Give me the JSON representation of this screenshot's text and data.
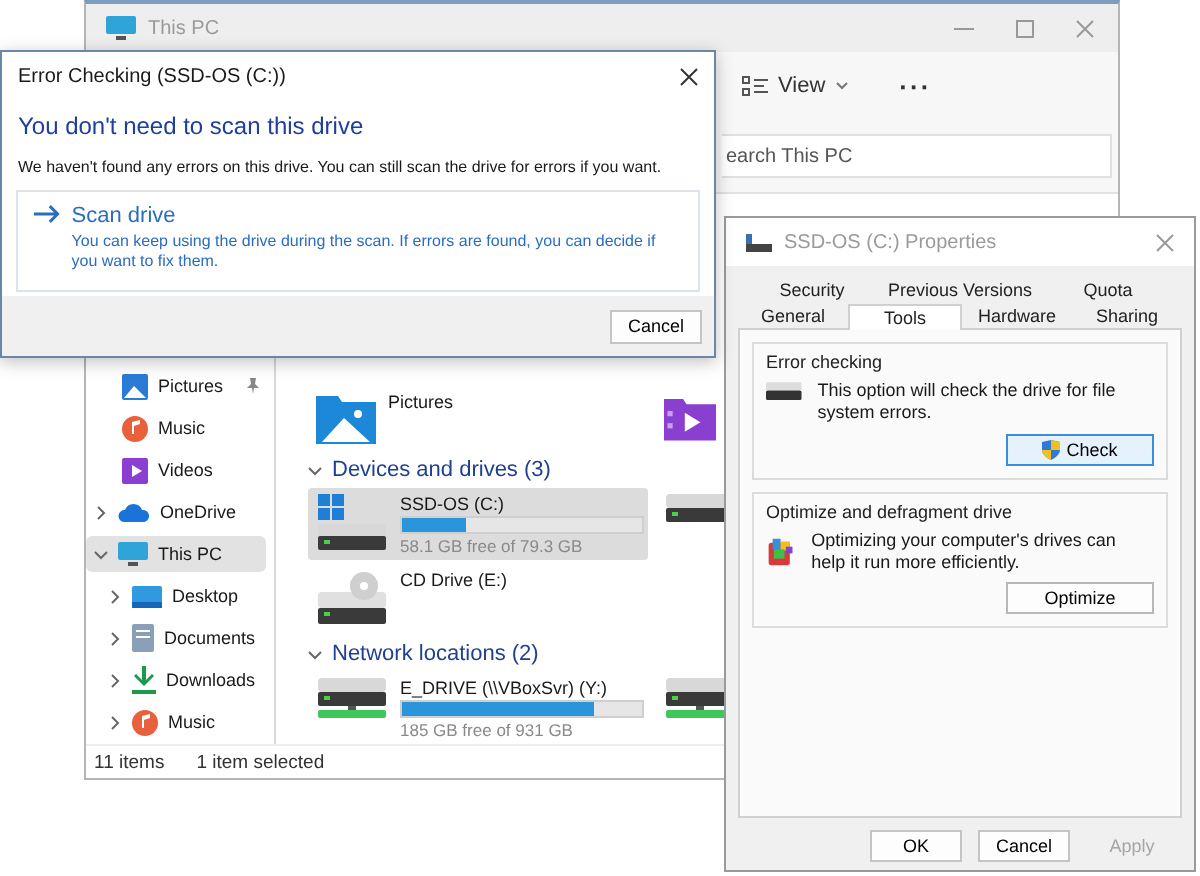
{
  "explorer": {
    "title": "This PC",
    "active": false,
    "toolbar": [
      {
        "kind": "view",
        "label": "View"
      },
      {
        "kind": "more",
        "label": "···"
      }
    ],
    "search": {
      "placeholder": "earch This PC"
    },
    "nav": [
      {
        "kind": "pictures",
        "label": "Pictures",
        "pinned": true,
        "selected": false
      },
      {
        "kind": "music",
        "label": "Music",
        "pinned": false,
        "selected": false
      },
      {
        "kind": "videos",
        "label": "Videos",
        "pinned": false,
        "selected": false
      },
      {
        "kind": "onedrive",
        "label": "OneDrive",
        "expanded": false,
        "selected": false
      },
      {
        "kind": "pc",
        "label": "This PC",
        "expanded": true,
        "selected": true,
        "children": [
          {
            "kind": "desktop",
            "label": "Desktop",
            "expanded": false,
            "selected": false
          },
          {
            "kind": "documents",
            "label": "Documents",
            "expanded": false,
            "selected": false
          },
          {
            "kind": "downloads",
            "label": "Downloads",
            "expanded": false,
            "selected": false
          },
          {
            "kind": "music",
            "label": "Music",
            "expanded": false,
            "selected": false
          }
        ]
      }
    ],
    "folders": [
      {
        "kind": "pictures",
        "label": "Pictures"
      },
      {
        "kind": "videos"
      }
    ],
    "groups": [
      {
        "title": "Devices and drives (3)",
        "expanded": true,
        "items": [
          {
            "kind": "system_drive",
            "name": "SSD-OS (C:)",
            "level": 0.27,
            "reading": "58.1 GB free of 79.3 GB",
            "selected": true
          },
          {
            "kind": "drive",
            "selected": false
          },
          {
            "kind": "cd",
            "name": "CD Drive (E:)",
            "selected": false
          }
        ]
      },
      {
        "title": "Network locations (2)",
        "expanded": true,
        "items": [
          {
            "kind": "network_drive",
            "name": "E_DRIVE (\\\\VBoxSvr) (Y:)",
            "level": 0.8,
            "reading": "185 GB free of 931 GB",
            "selected": false
          },
          {
            "kind": "network_drive",
            "selected": false
          }
        ]
      }
    ],
    "status_bar": [
      "11 items",
      "1 item selected"
    ]
  },
  "properties": {
    "title": "SSD-OS (C:) Properties",
    "active": false,
    "tab_rows": [
      [
        {
          "label": "Security",
          "selected": false
        },
        {
          "label": "Previous Versions",
          "selected": false
        },
        {
          "label": "Quota",
          "selected": false
        }
      ],
      [
        {
          "label": "General",
          "selected": false
        },
        {
          "label": "Tools",
          "selected": true
        },
        {
          "label": "Hardware",
          "selected": false
        },
        {
          "label": "Sharing",
          "selected": false
        }
      ]
    ],
    "sections": [
      {
        "kind": "error_check",
        "title": "Error checking",
        "text": "This option will check the drive for file system errors.",
        "button": "Check"
      },
      {
        "kind": "optimize",
        "title": "Optimize and defragment drive",
        "text": "Optimizing your computer's drives can help it run more efficiently.",
        "button": "Optimize"
      }
    ],
    "buttons": [
      {
        "label": "OK",
        "disabled": false
      },
      {
        "label": "Cancel",
        "disabled": false
      },
      {
        "label": "Apply",
        "disabled": true
      }
    ]
  },
  "dialog": {
    "title": "Error Checking (SSD-OS (C:))",
    "active": true,
    "heading": "You don't need to scan this drive",
    "message": "We haven't found any errors on this drive. You can still scan the drive for errors if you want.",
    "option": {
      "title": "Scan drive",
      "description": "You can keep using the drive during the scan. If errors are found, you can decide if you want to fix them."
    },
    "buttons": [
      "Cancel"
    ]
  }
}
